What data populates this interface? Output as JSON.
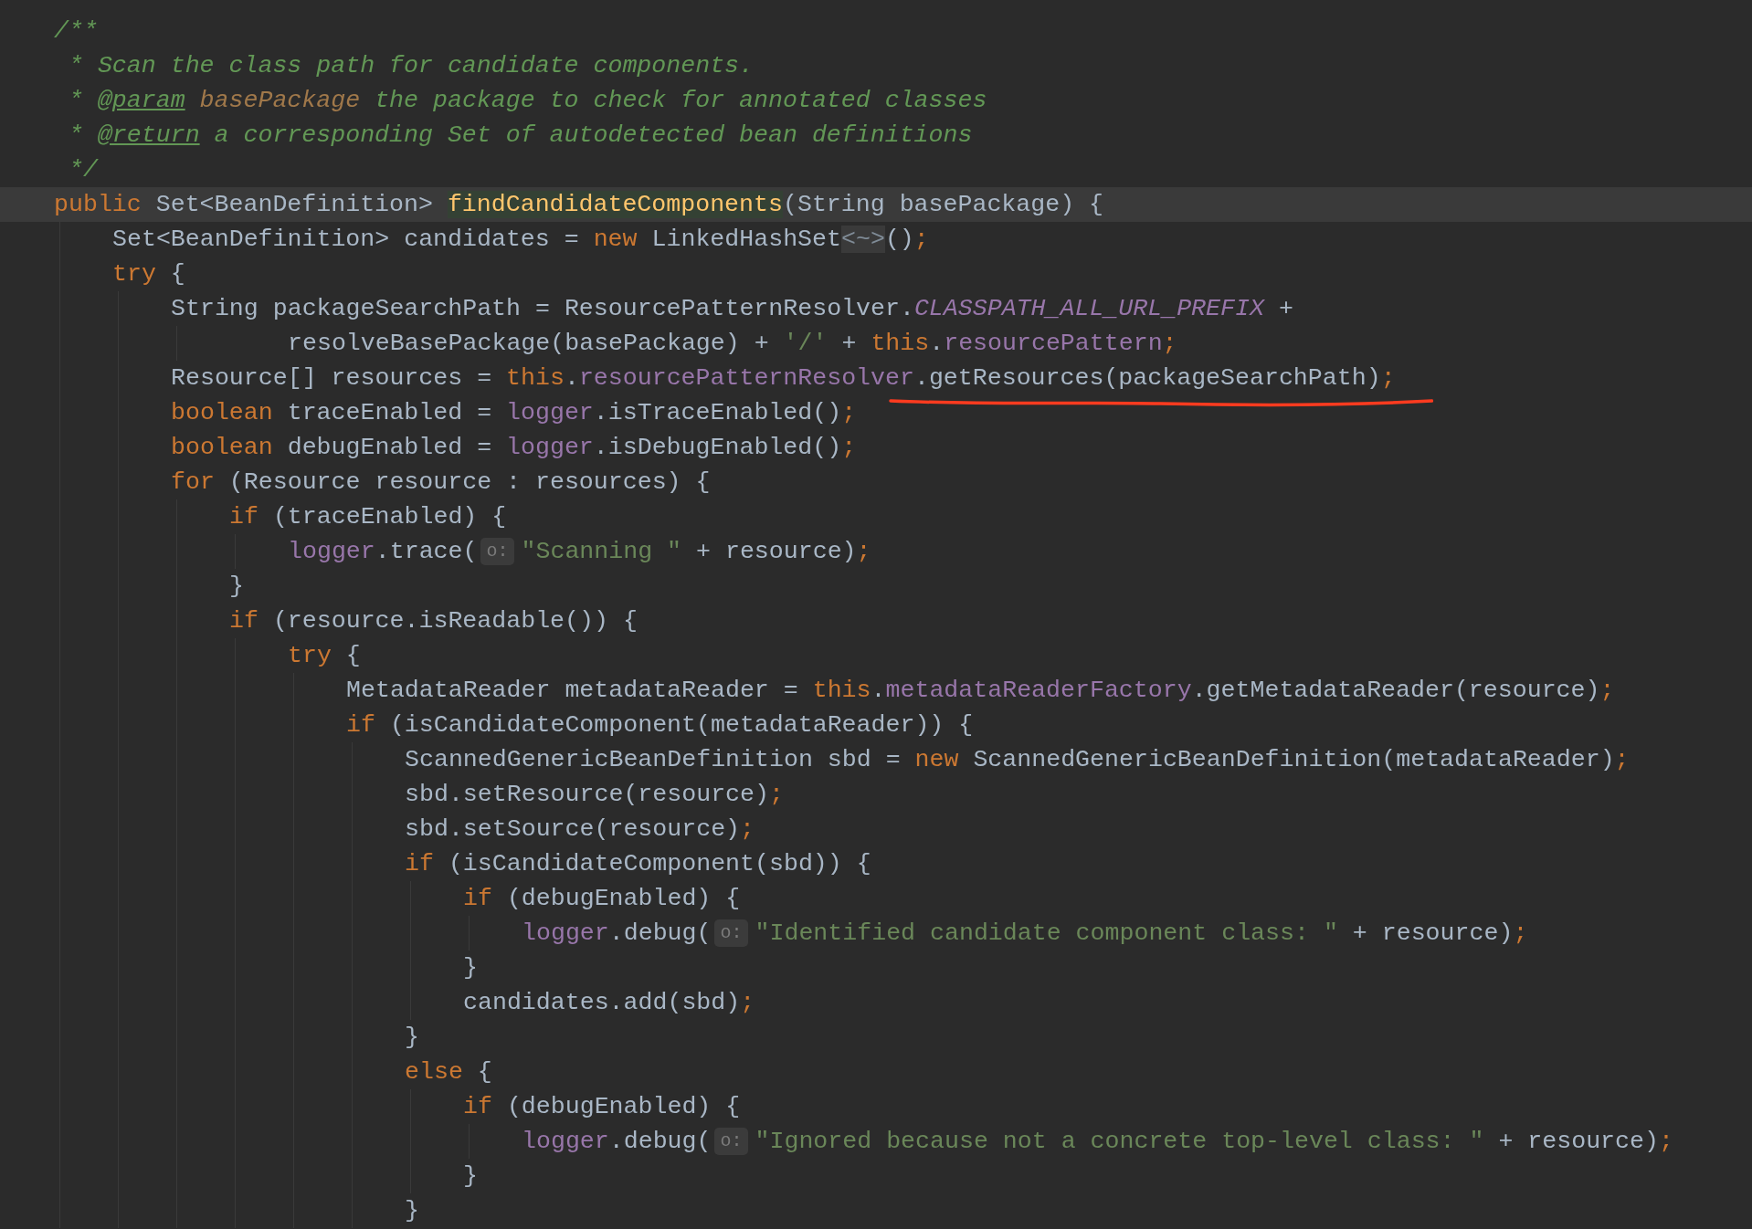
{
  "editor": {
    "lines": [
      {
        "kind": "code",
        "current": false,
        "tokens": [
          {
            "text": "/**",
            "kind": "comment"
          }
        ]
      },
      {
        "kind": "code",
        "current": false,
        "tokens": [
          {
            "text": " * Scan the class path for candidate components.",
            "kind": "comment"
          }
        ]
      },
      {
        "kind": "code",
        "current": false,
        "tokens": [
          {
            "text": " * ",
            "kind": "comment"
          },
          {
            "text": "@param",
            "kind": "doc_tag"
          },
          {
            "text": " basePackage",
            "kind": "doc_param"
          },
          {
            "text": " the package to check for annotated classes",
            "kind": "comment"
          }
        ]
      },
      {
        "kind": "code",
        "current": false,
        "tokens": [
          {
            "text": " * ",
            "kind": "comment"
          },
          {
            "text": "@return",
            "kind": "doc_tag"
          },
          {
            "text": " a corresponding Set of autodetected bean definitions",
            "kind": "comment"
          }
        ]
      },
      {
        "kind": "code",
        "current": false,
        "tokens": [
          {
            "text": " */",
            "kind": "comment"
          }
        ]
      },
      {
        "kind": "code",
        "current": true,
        "tokens": [
          {
            "text": "public",
            "kind": "keyword"
          },
          {
            "text": " Set<BeanDefinition> ",
            "kind": "plain"
          },
          {
            "text": "findCandidateComponents",
            "kind": "declaration"
          },
          {
            "text": "(String basePackage) {",
            "kind": "plain"
          }
        ],
        "children": [
          {
            "kind": "code",
            "current": false,
            "tokens": [
              {
                "text": "Set<BeanDefinition> candidates = ",
                "kind": "plain"
              },
              {
                "text": "new",
                "kind": "keyword"
              },
              {
                "text": " LinkedHashSet",
                "kind": "plain"
              },
              {
                "text": "<~>",
                "kind": "diamond"
              },
              {
                "text": "()",
                "kind": "plain"
              },
              {
                "text": ";",
                "kind": "keyword"
              }
            ]
          },
          {
            "kind": "code",
            "current": false,
            "tokens": [
              {
                "text": "try",
                "kind": "keyword"
              },
              {
                "text": " {",
                "kind": "plain"
              }
            ],
            "children": [
              {
                "kind": "code",
                "current": false,
                "tokens": [
                  {
                    "text": "String packageSearchPath = ResourcePatternResolver.",
                    "kind": "plain"
                  },
                  {
                    "text": "CLASSPATH_ALL_URL_PREFIX",
                    "kind": "constant"
                  },
                  {
                    "text": " +",
                    "kind": "plain"
                  }
                ],
                "children": [
                  {
                    "kind": "continuation",
                    "current": false,
                    "tokens": [
                      {
                        "text": "resolveBasePackage(basePackage) + ",
                        "kind": "plain"
                      },
                      {
                        "text": "'/'",
                        "kind": "string"
                      },
                      {
                        "text": " + ",
                        "kind": "plain"
                      },
                      {
                        "text": "this",
                        "kind": "keyword"
                      },
                      {
                        "text": ".",
                        "kind": "plain"
                      },
                      {
                        "text": "resourcePattern",
                        "kind": "field"
                      },
                      {
                        "text": ";",
                        "kind": "keyword"
                      }
                    ]
                  }
                ]
              },
              {
                "kind": "code",
                "current": false,
                "tokens": [
                  {
                    "text": "Resource[] resources = ",
                    "kind": "plain"
                  },
                  {
                    "text": "this",
                    "kind": "keyword"
                  },
                  {
                    "text": ".",
                    "kind": "plain"
                  },
                  {
                    "text": "resourcePatternResolver",
                    "kind": "field"
                  },
                  {
                    "text": ".getResources(packageSearchPath)",
                    "kind": "plain",
                    "underlined": true
                  },
                  {
                    "text": ";",
                    "kind": "keyword",
                    "underlined": true
                  }
                ]
              },
              {
                "kind": "code",
                "current": false,
                "tokens": [
                  {
                    "text": "boolean",
                    "kind": "keyword"
                  },
                  {
                    "text": " traceEnabled = ",
                    "kind": "plain"
                  },
                  {
                    "text": "logger",
                    "kind": "field"
                  },
                  {
                    "text": ".isTraceEnabled()",
                    "kind": "plain"
                  },
                  {
                    "text": ";",
                    "kind": "keyword"
                  }
                ]
              },
              {
                "kind": "code",
                "current": false,
                "tokens": [
                  {
                    "text": "boolean",
                    "kind": "keyword"
                  },
                  {
                    "text": " debugEnabled = ",
                    "kind": "plain"
                  },
                  {
                    "text": "logger",
                    "kind": "field"
                  },
                  {
                    "text": ".isDebugEnabled()",
                    "kind": "plain"
                  },
                  {
                    "text": ";",
                    "kind": "keyword"
                  }
                ]
              },
              {
                "kind": "code",
                "current": false,
                "tokens": [
                  {
                    "text": "for",
                    "kind": "keyword"
                  },
                  {
                    "text": " (Resource resource : resources) {",
                    "kind": "plain"
                  }
                ],
                "children": [
                  {
                    "kind": "code",
                    "current": false,
                    "tokens": [
                      {
                        "text": "if",
                        "kind": "keyword"
                      },
                      {
                        "text": " (traceEnabled) {",
                        "kind": "plain"
                      }
                    ],
                    "children": [
                      {
                        "kind": "code",
                        "current": false,
                        "tokens": [
                          {
                            "text": "logger",
                            "kind": "field"
                          },
                          {
                            "text": ".trace(",
                            "kind": "plain"
                          },
                          {
                            "text": "o:",
                            "kind": "hint"
                          },
                          {
                            "text": "\"Scanning \"",
                            "kind": "string"
                          },
                          {
                            "text": " + resource)",
                            "kind": "plain"
                          },
                          {
                            "text": ";",
                            "kind": "keyword"
                          }
                        ]
                      }
                    ]
                  },
                  {
                    "kind": "code",
                    "current": false,
                    "tokens": [
                      {
                        "text": "}",
                        "kind": "plain"
                      }
                    ]
                  },
                  {
                    "kind": "code",
                    "current": false,
                    "tokens": [
                      {
                        "text": "if",
                        "kind": "keyword"
                      },
                      {
                        "text": " (resource.isReadable()) {",
                        "kind": "plain"
                      }
                    ],
                    "children": [
                      {
                        "kind": "code",
                        "current": false,
                        "tokens": [
                          {
                            "text": "try",
                            "kind": "keyword"
                          },
                          {
                            "text": " {",
                            "kind": "plain"
                          }
                        ],
                        "children": [
                          {
                            "kind": "code",
                            "current": false,
                            "tokens": [
                              {
                                "text": "MetadataReader metadataReader = ",
                                "kind": "plain"
                              },
                              {
                                "text": "this",
                                "kind": "keyword"
                              },
                              {
                                "text": ".",
                                "kind": "plain"
                              },
                              {
                                "text": "metadataReaderFactory",
                                "kind": "field"
                              },
                              {
                                "text": ".getMetadataReader(resource)",
                                "kind": "plain"
                              },
                              {
                                "text": ";",
                                "kind": "keyword"
                              }
                            ]
                          },
                          {
                            "kind": "code",
                            "current": false,
                            "tokens": [
                              {
                                "text": "if",
                                "kind": "keyword"
                              },
                              {
                                "text": " (isCandidateComponent(metadataReader)) {",
                                "kind": "plain"
                              }
                            ],
                            "children": [
                              {
                                "kind": "code",
                                "current": false,
                                "tokens": [
                                  {
                                    "text": "ScannedGenericBeanDefinition sbd = ",
                                    "kind": "plain"
                                  },
                                  {
                                    "text": "new",
                                    "kind": "keyword"
                                  },
                                  {
                                    "text": " ScannedGenericBeanDefinition(metadataReader)",
                                    "kind": "plain"
                                  },
                                  {
                                    "text": ";",
                                    "kind": "keyword"
                                  }
                                ]
                              },
                              {
                                "kind": "code",
                                "current": false,
                                "tokens": [
                                  {
                                    "text": "sbd.setResource(resource)",
                                    "kind": "plain"
                                  },
                                  {
                                    "text": ";",
                                    "kind": "keyword"
                                  }
                                ]
                              },
                              {
                                "kind": "code",
                                "current": false,
                                "tokens": [
                                  {
                                    "text": "sbd.setSource(resource)",
                                    "kind": "plain"
                                  },
                                  {
                                    "text": ";",
                                    "kind": "keyword"
                                  }
                                ]
                              },
                              {
                                "kind": "code",
                                "current": false,
                                "tokens": [
                                  {
                                    "text": "if",
                                    "kind": "keyword"
                                  },
                                  {
                                    "text": " (isCandidateComponent(sbd)) {",
                                    "kind": "plain"
                                  }
                                ],
                                "children": [
                                  {
                                    "kind": "code",
                                    "current": false,
                                    "tokens": [
                                      {
                                        "text": "if",
                                        "kind": "keyword"
                                      },
                                      {
                                        "text": " (debugEnabled) {",
                                        "kind": "plain"
                                      }
                                    ],
                                    "children": [
                                      {
                                        "kind": "code",
                                        "current": false,
                                        "tokens": [
                                          {
                                            "text": "logger",
                                            "kind": "field"
                                          },
                                          {
                                            "text": ".debug(",
                                            "kind": "plain"
                                          },
                                          {
                                            "text": "o:",
                                            "kind": "hint"
                                          },
                                          {
                                            "text": "\"Identified candidate component class: \"",
                                            "kind": "string"
                                          },
                                          {
                                            "text": " + resource)",
                                            "kind": "plain"
                                          },
                                          {
                                            "text": ";",
                                            "kind": "keyword"
                                          }
                                        ]
                                      }
                                    ]
                                  },
                                  {
                                    "kind": "code",
                                    "current": false,
                                    "tokens": [
                                      {
                                        "text": "}",
                                        "kind": "plain"
                                      }
                                    ]
                                  },
                                  {
                                    "kind": "code",
                                    "current": false,
                                    "tokens": [
                                      {
                                        "text": "candidates.add(sbd)",
                                        "kind": "plain"
                                      },
                                      {
                                        "text": ";",
                                        "kind": "keyword"
                                      }
                                    ]
                                  }
                                ]
                              },
                              {
                                "kind": "code",
                                "current": false,
                                "tokens": [
                                  {
                                    "text": "}",
                                    "kind": "plain"
                                  }
                                ]
                              },
                              {
                                "kind": "code",
                                "current": false,
                                "tokens": [
                                  {
                                    "text": "else",
                                    "kind": "keyword"
                                  },
                                  {
                                    "text": " {",
                                    "kind": "plain"
                                  }
                                ],
                                "children": [
                                  {
                                    "kind": "code",
                                    "current": false,
                                    "tokens": [
                                      {
                                        "text": "if",
                                        "kind": "keyword"
                                      },
                                      {
                                        "text": " (debugEnabled) {",
                                        "kind": "plain"
                                      }
                                    ],
                                    "children": [
                                      {
                                        "kind": "code",
                                        "current": false,
                                        "tokens": [
                                          {
                                            "text": "logger",
                                            "kind": "field"
                                          },
                                          {
                                            "text": ".debug(",
                                            "kind": "plain"
                                          },
                                          {
                                            "text": "o:",
                                            "kind": "hint"
                                          },
                                          {
                                            "text": "\"Ignored because not a concrete top-level class: \"",
                                            "kind": "string"
                                          },
                                          {
                                            "text": " + resource)",
                                            "kind": "plain"
                                          },
                                          {
                                            "text": ";",
                                            "kind": "keyword"
                                          }
                                        ]
                                      }
                                    ]
                                  },
                                  {
                                    "kind": "code",
                                    "current": false,
                                    "tokens": [
                                      {
                                        "text": "}",
                                        "kind": "plain"
                                      }
                                    ]
                                  }
                                ]
                              },
                              {
                                "kind": "code",
                                "current": false,
                                "tokens": [
                                  {
                                    "text": "}",
                                    "kind": "plain"
                                  }
                                ]
                              }
                            ]
                          }
                        ]
                      }
                    ]
                  }
                ]
              }
            ]
          }
        ]
      }
    ]
  }
}
